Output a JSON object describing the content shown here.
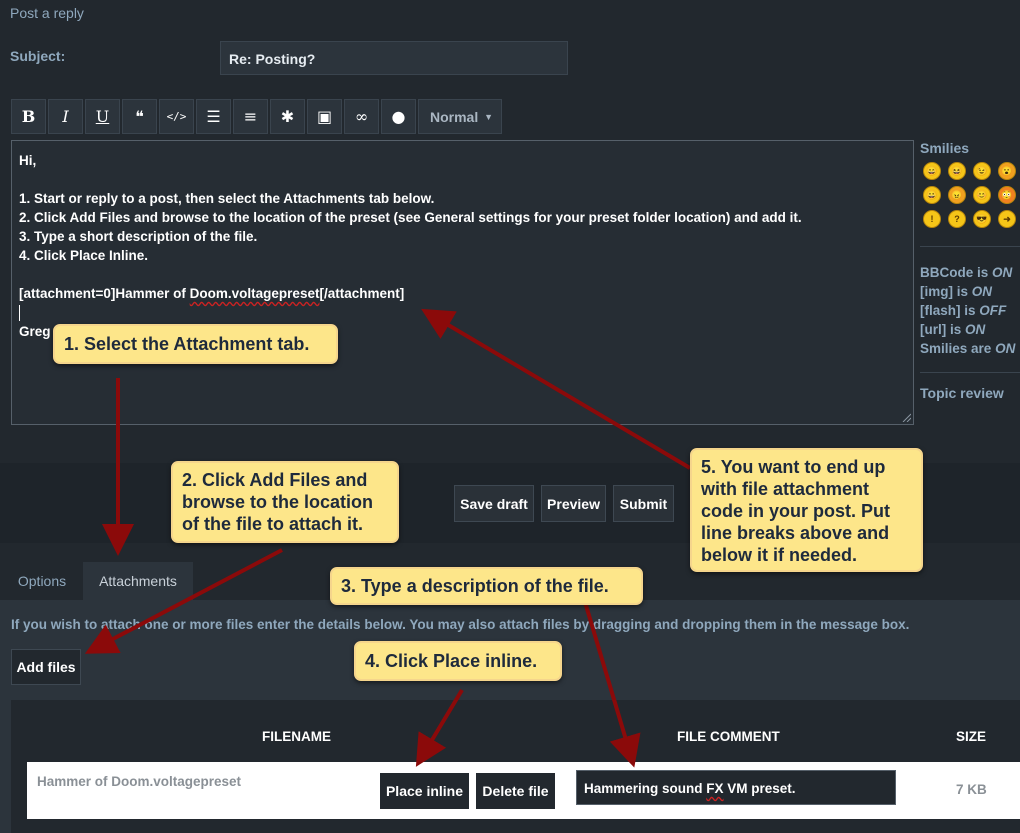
{
  "page": {
    "heading": "Post a reply"
  },
  "subject": {
    "label": "Subject:",
    "value": "Re: Posting?"
  },
  "toolbar": {
    "buttons": [
      {
        "name": "bold-button",
        "glyph": "B"
      },
      {
        "name": "italic-button",
        "glyph": "I"
      },
      {
        "name": "underline-button",
        "glyph": "U"
      },
      {
        "name": "quote-button",
        "glyph": "❝"
      },
      {
        "name": "code-button",
        "glyph": "</>"
      },
      {
        "name": "list-button",
        "glyph": "☰"
      },
      {
        "name": "numbered-list-button",
        "glyph": "≡"
      },
      {
        "name": "list-item-button",
        "glyph": "✱"
      },
      {
        "name": "image-button",
        "glyph": "▣"
      },
      {
        "name": "link-button",
        "glyph": "∞"
      },
      {
        "name": "color-button",
        "glyph": "●"
      }
    ],
    "font_size": "Normal",
    "dropdown_arrow": "▼"
  },
  "editor": {
    "lines": [
      "Hi,",
      "",
      "1. Start or reply to a post, then select the Attachments tab below.",
      "2. Click Add Files and browse to the location of the preset (see General settings for your preset folder location) and add it.",
      "3. Type a short description of the file.",
      "4. Click Place Inline.",
      "",
      "",
      "",
      "Greg"
    ],
    "attachment_prefix": "[attachment=0]Hammer of ",
    "attachment_squiggle": "Doom.voltagepreset",
    "attachment_suffix": "[/attachment]"
  },
  "sidebar": {
    "smilies_title": "Smilies",
    "smilies": [
      "😄",
      "😆",
      "😉",
      "😮",
      "😀",
      "😠",
      "😊",
      "😳",
      "!",
      "?",
      "😎",
      "➜"
    ],
    "bbcode": {
      "label": "BBCode is ",
      "state": "ON"
    },
    "img": {
      "label": "[img] is ",
      "state": "ON"
    },
    "flash": {
      "label": "[flash] is ",
      "state": "OFF"
    },
    "url": {
      "label": "[url] is ",
      "state": "ON"
    },
    "smilies_status": {
      "label": "Smilies are ",
      "state": "ON"
    },
    "topic_review": "Topic review"
  },
  "actions": {
    "save_draft": "Save draft",
    "preview": "Preview",
    "submit": "Submit"
  },
  "tabs": {
    "options": "Options",
    "attachments": "Attachments"
  },
  "attachments": {
    "info": "If you wish to attach one or more files enter the details below. You may also attach files by dragging and dropping them in the message box.",
    "add_files": "Add files",
    "columns": {
      "filename": "FILENAME",
      "file_comment": "FILE COMMENT",
      "size": "SIZE"
    },
    "file": {
      "name": "Hammer of Doom.voltagepreset",
      "place_inline": "Place inline",
      "delete_file": "Delete file",
      "comment_prefix": "Hammering sound ",
      "comment_squiggle": "FX",
      "comment_suffix": " VM preset.",
      "size": "7 KB"
    }
  },
  "callouts": {
    "c1": "1. Select the Attachment tab.",
    "c2": "2. Click Add Files and browse to the location of the file to attach it.",
    "c3": "3. Type a description of the file.",
    "c4": "4. Click Place inline.",
    "c5": "5. You want to end up with file attachment code in your post. Put line breaks above and below it if needed."
  },
  "colors": {
    "background": "#22282e",
    "callout": "#fde68a",
    "arrow": "#8b0a0a",
    "link_text": "#8fa8bd"
  }
}
